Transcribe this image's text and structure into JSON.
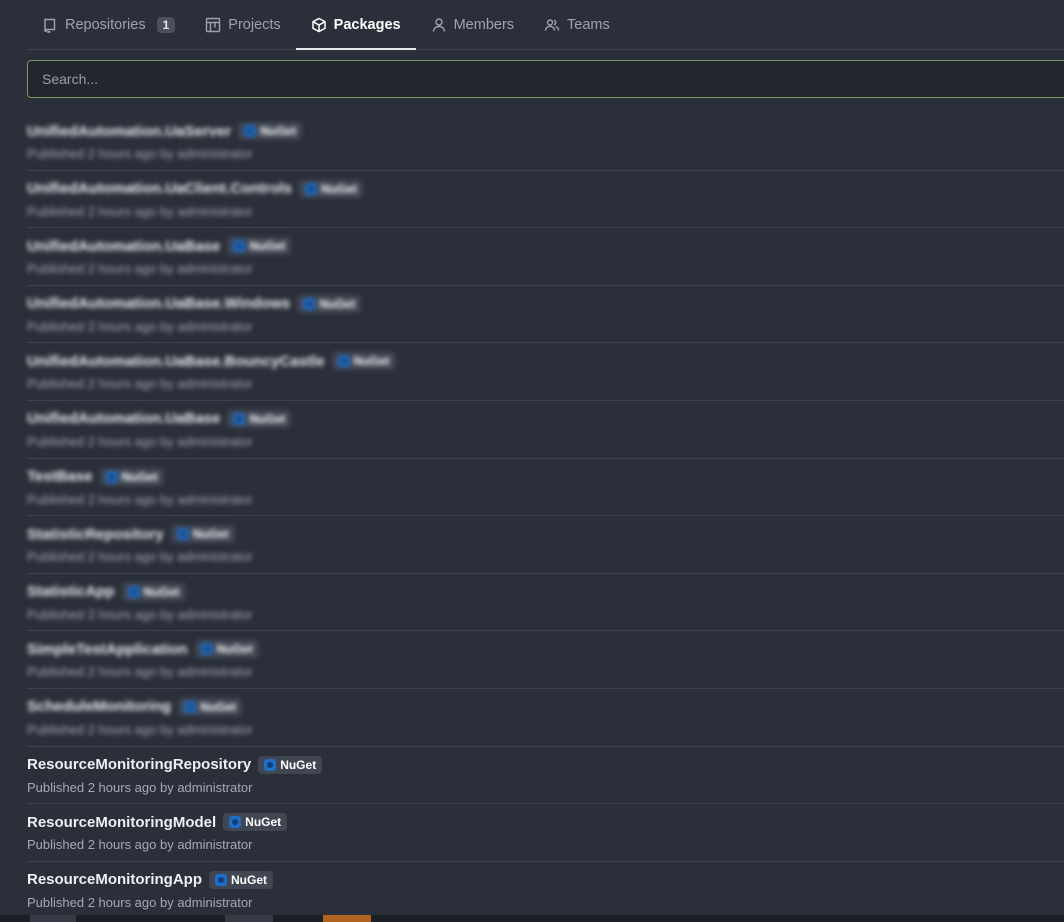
{
  "tabs": [
    {
      "label": "Repositories",
      "icon": "repo-icon",
      "count": "1",
      "active": false
    },
    {
      "label": "Projects",
      "icon": "project-icon",
      "active": false
    },
    {
      "label": "Packages",
      "icon": "package-icon",
      "active": true
    },
    {
      "label": "Members",
      "icon": "person-icon",
      "active": false
    },
    {
      "label": "Teams",
      "icon": "people-icon",
      "active": false
    }
  ],
  "search": {
    "placeholder": "Search...",
    "value": ""
  },
  "packages": [
    {
      "name": "UnifiedAutomation.UaServer",
      "type": "NuGet",
      "meta": "Published 2 hours ago by administrator",
      "blurred": true
    },
    {
      "name": "UnifiedAutomation.UaClient.Controls",
      "type": "NuGet",
      "meta": "Published 2 hours ago by administrator",
      "blurred": true
    },
    {
      "name": "UnifiedAutomation.UaBase",
      "type": "NuGet",
      "meta": "Published 2 hours ago by administrator",
      "blurred": true
    },
    {
      "name": "UnifiedAutomation.UaBase.Windows",
      "type": "NuGet",
      "meta": "Published 2 hours ago by administrator",
      "blurred": true
    },
    {
      "name": "UnifiedAutomation.UaBase.BouncyCastle",
      "type": "NuGet",
      "meta": "Published 2 hours ago by administrator",
      "blurred": true
    },
    {
      "name": "UnifiedAutomation.UaBase",
      "type": "NuGet",
      "meta": "Published 2 hours ago by administrator",
      "blurred": true
    },
    {
      "name": "TestBase",
      "type": "NuGet",
      "meta": "Published 2 hours ago by administrator",
      "blurred": true
    },
    {
      "name": "StatisticRepository",
      "type": "NuGet",
      "meta": "Published 2 hours ago by administrator",
      "blurred": true
    },
    {
      "name": "StatisticApp",
      "type": "NuGet",
      "meta": "Published 2 hours ago by administrator",
      "blurred": true
    },
    {
      "name": "SimpleTestApplication",
      "type": "NuGet",
      "meta": "Published 2 hours ago by administrator",
      "blurred": true
    },
    {
      "name": "ScheduleMonitoring",
      "type": "NuGet",
      "meta": "Published 2 hours ago by administrator",
      "blurred": true
    },
    {
      "name": "ResourceMonitoringRepository",
      "type": "NuGet",
      "meta": "Published 2 hours ago by administrator",
      "blurred": false
    },
    {
      "name": "ResourceMonitoringModel",
      "type": "NuGet",
      "meta": "Published 2 hours ago by administrator",
      "blurred": false
    },
    {
      "name": "ResourceMonitoringApp",
      "type": "NuGet",
      "meta": "Published 2 hours ago by administrator",
      "blurred": false
    }
  ],
  "colors": {
    "accent_search_border": "#7a9a61",
    "nuget_blue": "#1f6dc5",
    "background": "#2b2f3a"
  }
}
